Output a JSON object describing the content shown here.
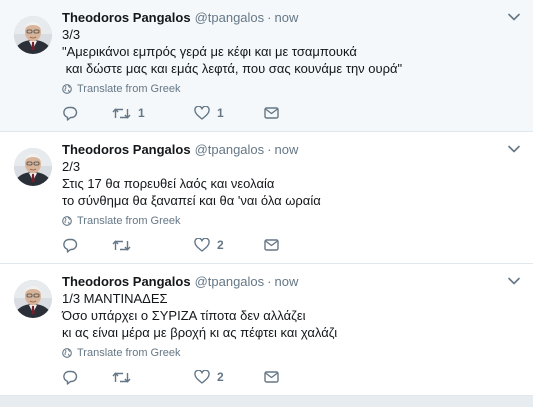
{
  "tweets": [
    {
      "name": "Theodoros Pangalos",
      "handle": "@tpangalos",
      "dot": "·",
      "time": "now",
      "lines": [
        "3/3",
        "\"Αμερικάνοι εμπρός γερά με κέφι και με τσαμπουκά",
        " και δώστε μας και εμάς λεφτά, που σας κουνάμε την ουρά\""
      ],
      "translate": "Translate from Greek",
      "reply_count": "",
      "retweet_count": "1",
      "like_count": "1"
    },
    {
      "name": "Theodoros Pangalos",
      "handle": "@tpangalos",
      "dot": "·",
      "time": "now",
      "lines": [
        "2/3",
        "Στις 17 θα πορευθεί λαός και νεολαία",
        "το σύνθημα θα ξαναπεί και θα 'ναι όλα ωραία"
      ],
      "translate": "Translate from Greek",
      "reply_count": "",
      "retweet_count": "",
      "like_count": "2"
    },
    {
      "name": "Theodoros Pangalos",
      "handle": "@tpangalos",
      "dot": "·",
      "time": "now",
      "lines": [
        "1/3 ΜΑΝΤΙΝΑΔΕΣ",
        "Όσο υπάρχει ο ΣΥΡΙΖΑ τίποτα δεν αλλάζει",
        "κι ας είναι μέρα με βροχή κι ας πέφτει και χαλάζι"
      ],
      "translate": "Translate from Greek",
      "reply_count": "",
      "retweet_count": "",
      "like_count": "2"
    }
  ],
  "icons": {
    "caret": "chevron-down-icon",
    "translate": "globe-icon",
    "reply": "reply-icon",
    "retweet": "retweet-icon",
    "like": "heart-icon",
    "dm": "envelope-icon"
  },
  "colors": {
    "text": "#14171a",
    "muted": "#657786",
    "border": "#e1e8ed"
  }
}
